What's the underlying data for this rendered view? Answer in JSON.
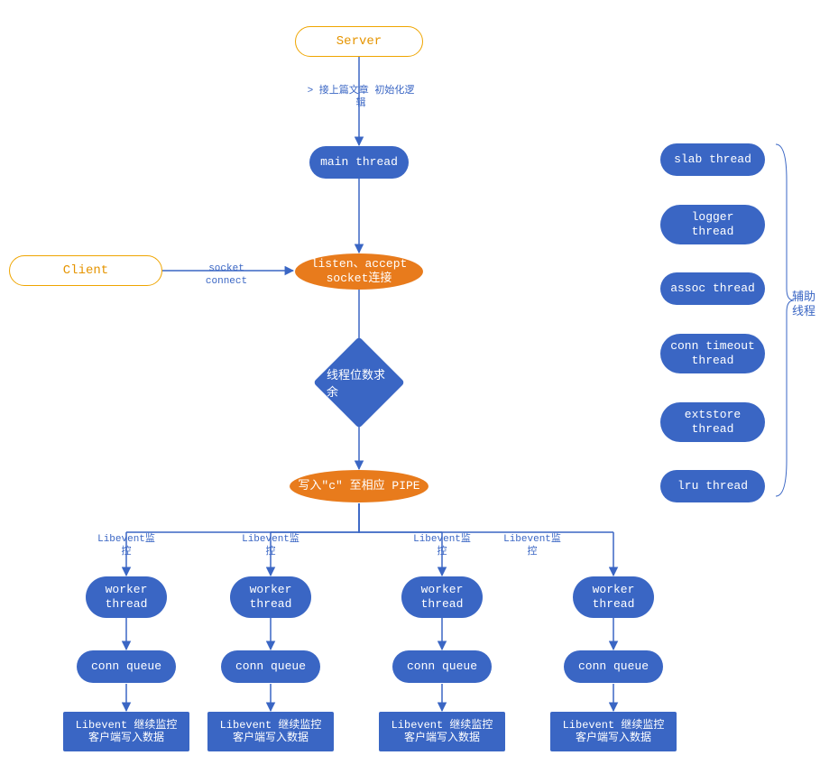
{
  "nodes": {
    "server": "Server",
    "client": "Client",
    "main_thread": "main thread",
    "listen_accept": "listen、accept\nsocket连接",
    "thread_mod": "线程位数求余",
    "write_c_pipe": "写入\"c\" 至相应 PIPE",
    "worker_thread": "worker\nthread",
    "conn_queue": "conn queue",
    "libevent_box": "Libevent 继续监控\n客户端写入数据",
    "slab_thread": "slab thread",
    "logger_thread": "logger\nthread",
    "assoc_thread": "assoc thread",
    "conn_timeout_thread": "conn timeout\nthread",
    "extstore_thread": "extstore\nthread",
    "lru_thread": "lru thread"
  },
  "edges": {
    "init": "> 接上篇文章\n初始化逻辑",
    "socket_connect": "socket connect",
    "libevent_monitor": "Libevent监控"
  },
  "labels": {
    "helper_threads": "辅助\n线程"
  },
  "colors": {
    "blue": "#3a66c4",
    "orange_fill": "#e87b1c",
    "orange_stroke": "#efa500"
  }
}
